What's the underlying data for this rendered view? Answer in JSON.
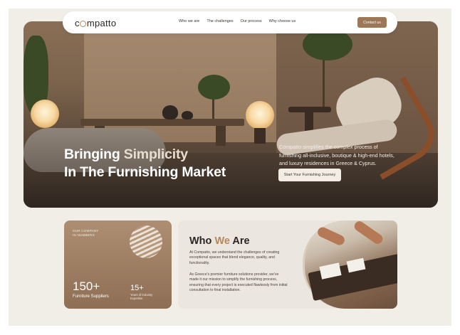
{
  "nav": {
    "logo": "compatto",
    "links": [
      "Who we are",
      "The challenges",
      "Our process",
      "Why choose us"
    ],
    "cta": "Contact us"
  },
  "hero": {
    "title_line1_a": "Bringing ",
    "title_line1_b": "Simplicity",
    "title_line2": "In The Furnishing Market",
    "description": "Compatto simplifies the complex process of furnishing all-inclusive, boutique & high-end hotels, and luxury residences in Greece & Cyprus.",
    "cta": "Start Your Furnishing Journey"
  },
  "stats": {
    "kicker_line1": "OUR COMPANY",
    "kicker_line2": "IN NUMBERS",
    "stat1_value": "150+",
    "stat1_label": "Furniture Suppliers",
    "stat2_value": "15+",
    "stat2_label_line1": "Years of Industry",
    "stat2_label_line2": "Expertise"
  },
  "about": {
    "title_a": "Who ",
    "title_b": "We",
    "title_c": " Are",
    "p1": "At Compatto, we understand the challenges of creating exceptional spaces that blend elegance, quality, and functionality.",
    "p2": "As Greece's premier furniture solutions provider, we've made it our mission to simplify the furnishing process, ensuring that every project is executed flawlessly from initial consultation to final installation."
  },
  "colors": {
    "accent": "#b5895e",
    "cta_brown": "#9c7858",
    "background": "#f1eee8"
  }
}
